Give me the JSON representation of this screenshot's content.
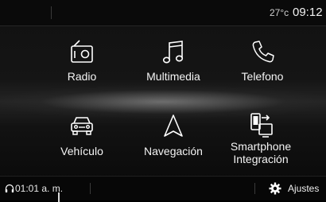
{
  "status_bar": {
    "night_mode_icon": "crescent-moon-icon",
    "temperature": "27°c",
    "time": "09:12"
  },
  "menu": {
    "items": [
      {
        "label": "Radio",
        "icon": "radio-icon"
      },
      {
        "label": "Multimedia",
        "icon": "music-note-icon"
      },
      {
        "label": "Telefono",
        "icon": "phone-icon"
      },
      {
        "label": "Vehículo",
        "icon": "car-icon"
      },
      {
        "label": "Navegación",
        "icon": "navigation-arrow-icon"
      },
      {
        "label": "Smartphone",
        "label_line2": "Integración",
        "icon": "smartphone-integration-icon"
      }
    ]
  },
  "bottom_bar": {
    "now_playing_icon": "headphones-icon",
    "now_playing": "01:01 a. m.",
    "settings_icon": "gear-icon",
    "settings_label": "Ajustes"
  },
  "colors": {
    "background": "#000000",
    "text": "#ffffff",
    "icon_stroke": "#ffffff"
  }
}
